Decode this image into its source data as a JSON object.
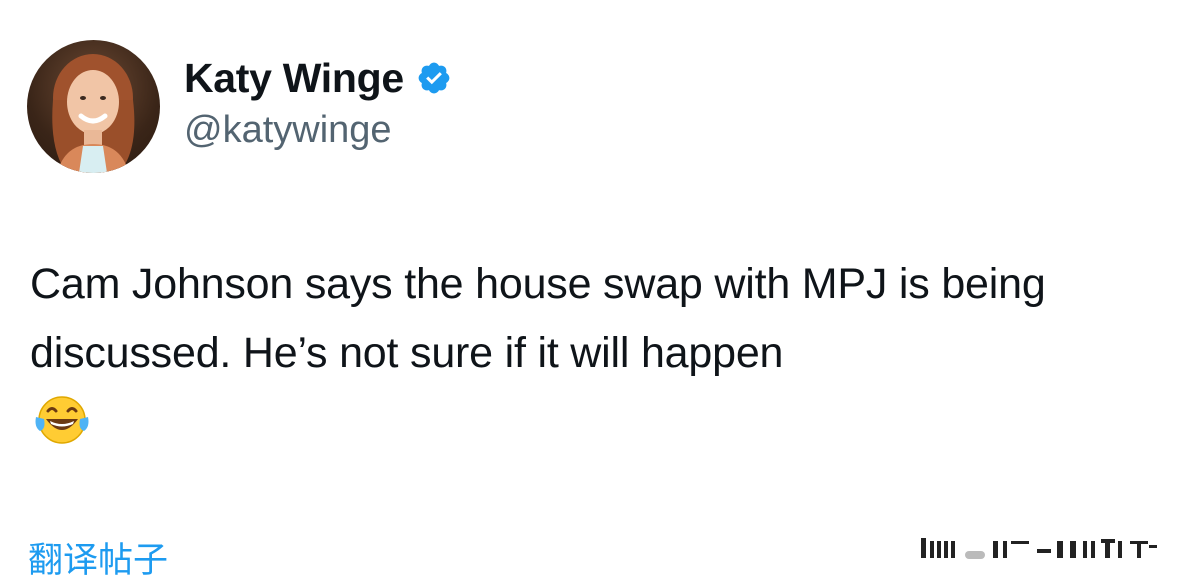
{
  "author": {
    "display_name": "Katy Winge",
    "handle": "@katywinge",
    "verified": true,
    "avatar_icon": "profile-photo-avatar",
    "verified_icon": "verified-badge-icon",
    "verified_color": "#1d9bf0"
  },
  "tweet": {
    "text": "Cam Johnson says the house swap with MPJ is being discussed. He’s not sure if it will happen",
    "emoji": "😂",
    "emoji_icon": "face-with-tears-of-joy-icon"
  },
  "footer": {
    "translate_label": "翻译帖子",
    "translate_color": "#1d9bf0"
  }
}
